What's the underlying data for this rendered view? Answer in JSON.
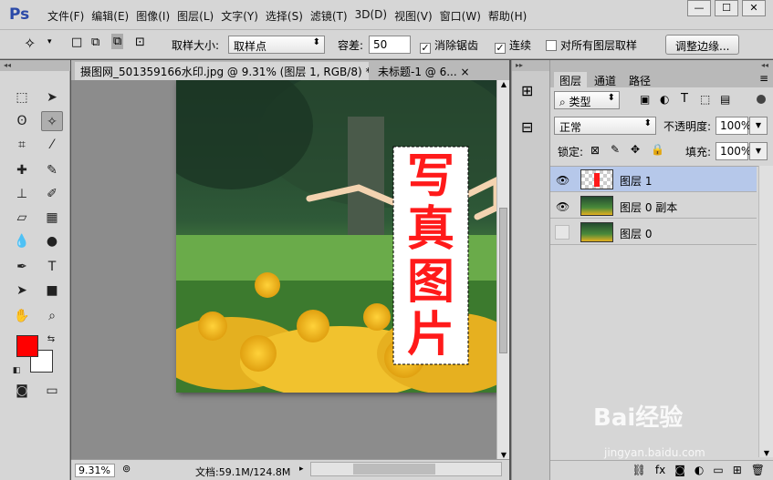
{
  "app": {
    "logo": "Ps"
  },
  "menu": [
    "文件(F)",
    "编辑(E)",
    "图像(I)",
    "图层(L)",
    "文字(Y)",
    "选择(S)",
    "滤镜(T)",
    "3D(D)",
    "视图(V)",
    "窗口(W)",
    "帮助(H)"
  ],
  "window_buttons": [
    "—",
    "☐",
    "✕"
  ],
  "options": {
    "sample_size_label": "取样大小:",
    "sample_size_value": "取样点",
    "tolerance_label": "容差:",
    "tolerance_value": "50",
    "antialias_label": "消除锯齿",
    "contiguous_label": "连续",
    "all_layers_label": "对所有图层取样",
    "refine_edge_button": "调整边缘..."
  },
  "tabs": [
    {
      "label": "摄图网_501359166水印.jpg @ 9.31% (图层 1, RGB/8) *",
      "close": "×"
    },
    {
      "label": "未标题-1 @ 6...",
      "close": "×"
    }
  ],
  "canvas_text": [
    "写",
    "真",
    "图",
    "片"
  ],
  "status": {
    "zoom": "9.31%",
    "doc": "文档:59.1M/124.8M"
  },
  "layers_panel": {
    "tabs": [
      "图层",
      "通道",
      "路径"
    ],
    "filter_label": "类型",
    "blend_mode": "正常",
    "opacity_label": "不透明度:",
    "opacity_value": "100%",
    "lock_label": "锁定:",
    "fill_label": "填充:",
    "fill_value": "100%",
    "layers": [
      {
        "name": "图层 1",
        "visible": true,
        "selected": true
      },
      {
        "name": "图层 0 副本",
        "visible": true,
        "selected": false
      },
      {
        "name": "图层 0",
        "visible": false,
        "selected": false
      }
    ]
  },
  "watermark": {
    "brand": "Bai经验",
    "url": "jingyan.baidu.com"
  },
  "colors": {
    "foreground": "#ff0000",
    "background": "#ffffff",
    "text_red": "#ff1a1a",
    "selected_layer": "#b6c8ea"
  }
}
